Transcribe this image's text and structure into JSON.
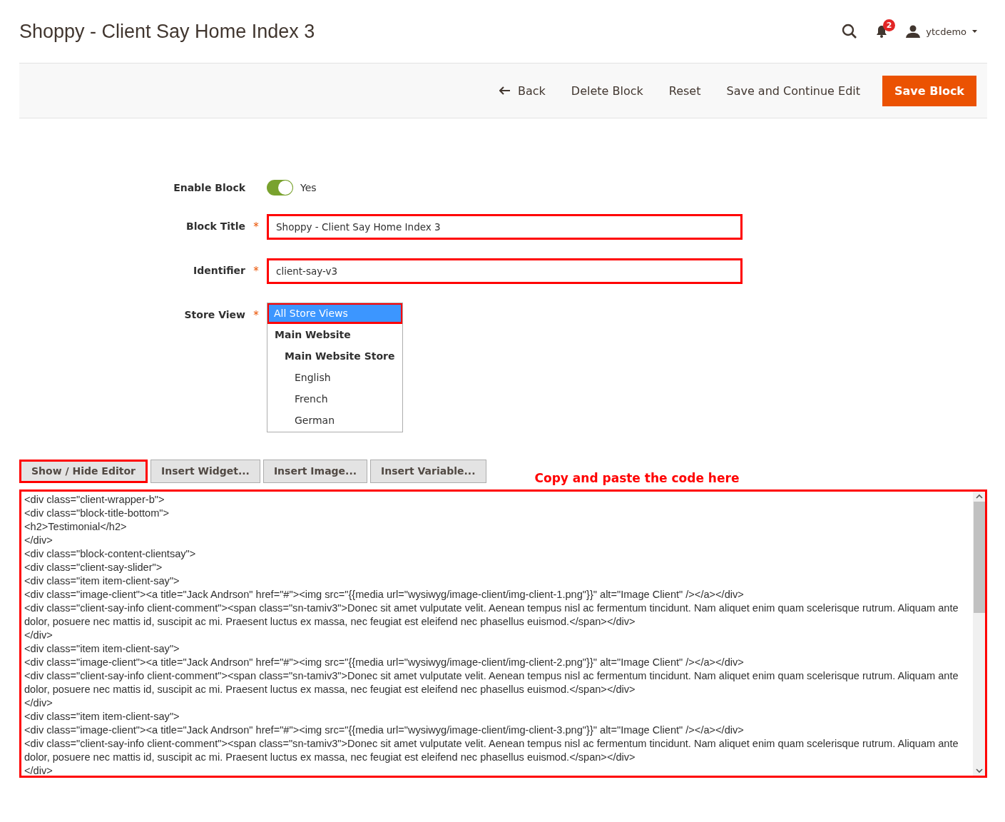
{
  "page_title": "Shoppy - Client Say Home Index 3",
  "header": {
    "notifications": "2",
    "user": "ytcdemo"
  },
  "actions": [
    {
      "label": "Back",
      "kind": "back"
    },
    {
      "label": "Delete Block",
      "kind": "plain"
    },
    {
      "label": "Reset",
      "kind": "plain"
    },
    {
      "label": "Save and Continue Edit",
      "kind": "plain"
    },
    {
      "label": "Save Block",
      "kind": "primary"
    }
  ],
  "form": {
    "enable_block": {
      "label": "Enable Block",
      "on": true,
      "value": "Yes"
    },
    "block_title": {
      "label": "Block Title",
      "required_mark": "*",
      "value": "Shoppy - Client Say Home Index 3",
      "highlighted": true
    },
    "identifier": {
      "label": "Identifier",
      "required_mark": "*",
      "value": "client-say-v3",
      "highlighted": true
    },
    "store_view": {
      "label": "Store View",
      "required_mark": "*",
      "options": [
        {
          "label": "All Store Views",
          "selected": true,
          "highlighted": true
        },
        {
          "label": "Main Website",
          "selected": false,
          "children": [
            {
              "label": "Main Website Store",
              "selected": false,
              "children": [
                {
                  "label": "English",
                  "selected": false
                },
                {
                  "label": "French",
                  "selected": false
                },
                {
                  "label": "German",
                  "selected": false
                }
              ]
            }
          ]
        }
      ]
    }
  },
  "editor_buttons": [
    {
      "label": "Show / Hide Editor",
      "highlighted": true
    },
    {
      "label": "Insert Widget...",
      "highlighted": false
    },
    {
      "label": "Insert Image...",
      "highlighted": false
    },
    {
      "label": "Insert Variable...",
      "highlighted": false
    }
  ],
  "annotation": "Copy and paste the code here",
  "code_editor": {
    "highlighted": true,
    "lines": [
      "<div class=\"client-wrapper-b\">",
      "<div class=\"block-title-bottom\">",
      "<h2>Testimonial</h2>",
      "</div>",
      "<div class=\"block-content-clientsay\">",
      "<div class=\"client-say-slider\">",
      "<div class=\"item item-client-say\">",
      "<div class=\"image-client\"><a title=\"Jack Andrson\" href=\"#\"><img src=\"{{media url=\"wysiwyg/image-client/img-client-1.png\"}}\" alt=\"Image Client\" /></a></div>",
      "<div class=\"client-say-info client-comment\"><span class=\"sn-tamiv3\">Donec sit amet vulputate velit. Aenean tempus nisl ac fermentum tincidunt. Nam aliquet enim quam scelerisque rutrum. Aliquam ante dolor, posuere nec mattis id, suscipit ac mi. Praesent luctus ex massa, nec feugiat est eleifend nec phasellus euismod.</span></div>",
      "</div>",
      "<div class=\"item item-client-say\">",
      "<div class=\"image-client\"><a title=\"Jack Andrson\" href=\"#\"><img src=\"{{media url=\"wysiwyg/image-client/img-client-2.png\"}}\" alt=\"Image Client\" /></a></div>",
      "<div class=\"client-say-info client-comment\"><span class=\"sn-tamiv3\">Donec sit amet vulputate velit. Aenean tempus nisl ac fermentum tincidunt. Nam aliquet enim quam scelerisque rutrum. Aliquam ante dolor, posuere nec mattis id, suscipit ac mi. Praesent luctus ex massa, nec feugiat est eleifend nec phasellus euismod.</span></div>",
      "</div>",
      "<div class=\"item item-client-say\">",
      "<div class=\"image-client\"><a title=\"Jack Andrson\" href=\"#\"><img src=\"{{media url=\"wysiwyg/image-client/img-client-3.png\"}}\" alt=\"Image Client\" /></a></div>",
      "<div class=\"client-say-info client-comment\"><span class=\"sn-tamiv3\">Donec sit amet vulputate velit. Aenean tempus nisl ac fermentum tincidunt. Nam aliquet enim quam scelerisque rutrum. Aliquam ante dolor, posuere nec mattis id, suscipit ac mi. Praesent luctus ex massa, nec feugiat est eleifend nec phasellus euismod.</span></div>",
      "</div>"
    ]
  }
}
